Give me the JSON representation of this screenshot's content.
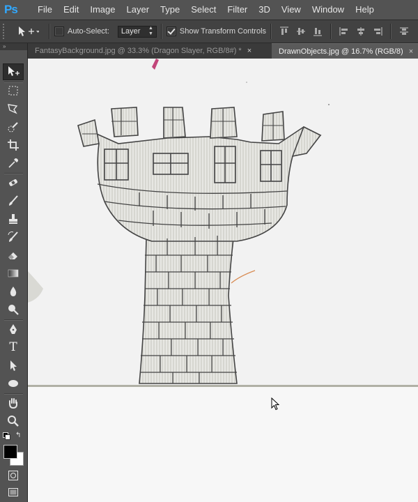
{
  "app": {
    "logo": "Ps",
    "menu": [
      "File",
      "Edit",
      "Image",
      "Layer",
      "Type",
      "Select",
      "Filter",
      "3D",
      "View",
      "Window",
      "Help"
    ]
  },
  "options": {
    "auto_select_label": "Auto-Select:",
    "auto_select_checked": false,
    "layer_select_value": "Layer",
    "show_transform_label": "Show Transform Controls",
    "show_transform_checked": true
  },
  "tabs": [
    {
      "label": "FantasyBackground.jpg @ 33.3% (Dragon Slayer, RGB/8#) *",
      "close": "×",
      "active": false
    },
    {
      "label": "DrawnObjects.jpg @ 16.7% (RGB/8)",
      "close": "×",
      "active": true
    }
  ],
  "tools_header": "»",
  "colors": {
    "accent": "#31a8ff",
    "menubar": "#535353",
    "panel": "#535353",
    "canvas": "#f2f2f2",
    "sketch": "#4a4a4a"
  },
  "tools": [
    "move-icon",
    "marquee-icon",
    "lasso-icon",
    "quick-selection-icon",
    "crop-icon",
    "eyedropper-icon",
    "healing-brush-icon",
    "brush-icon",
    "clone-stamp-icon",
    "history-brush-icon",
    "eraser-icon",
    "gradient-icon",
    "blur-icon",
    "dodge-icon",
    "pen-icon",
    "type-icon",
    "path-selection-icon",
    "ellipse-icon",
    "hand-icon",
    "zoom-icon"
  ],
  "type_tool_glyph": "T"
}
